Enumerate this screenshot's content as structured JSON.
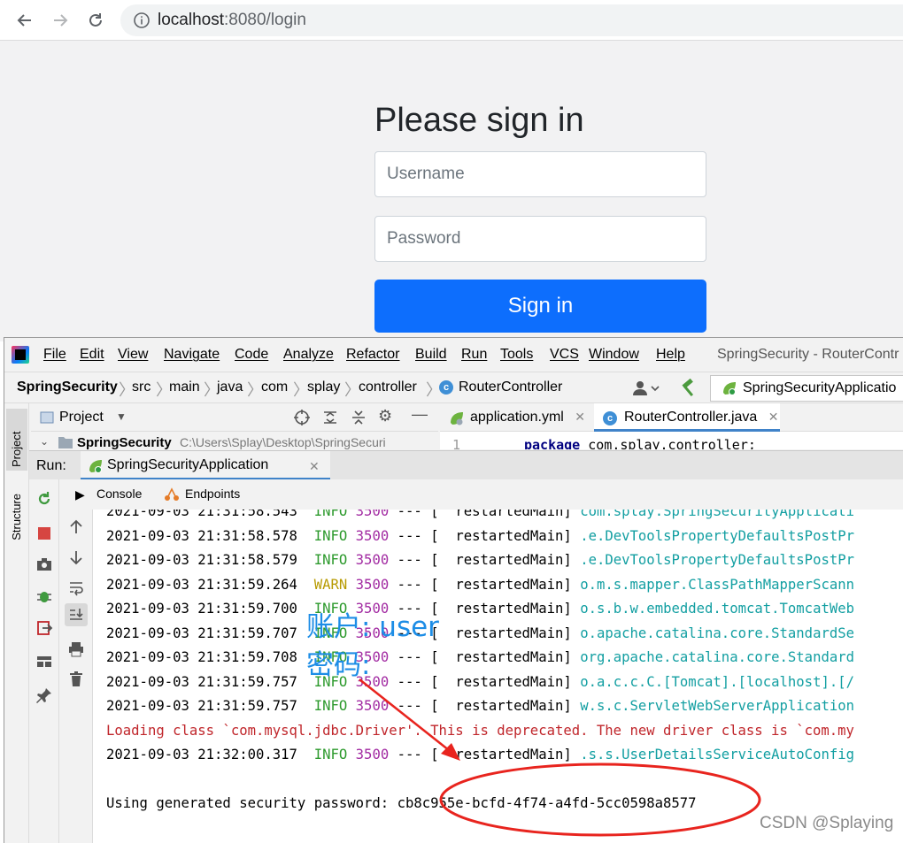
{
  "browser": {
    "url_host": "localhost",
    "url_rest": ":8080/login"
  },
  "login": {
    "title": "Please sign in",
    "username_placeholder": "Username",
    "password_placeholder": "Password",
    "signin_label": "Sign in",
    "button_color": "#0d6efd"
  },
  "ide": {
    "menu": [
      "File",
      "Edit",
      "View",
      "Navigate",
      "Code",
      "Analyze",
      "Refactor",
      "Build",
      "Run",
      "Tools",
      "VCS",
      "Window",
      "Help"
    ],
    "window_title": "SpringSecurity - RouterContr",
    "breadcrumbs": [
      "SpringSecurity",
      "src",
      "main",
      "java",
      "com",
      "splay",
      "controller",
      "RouterController"
    ],
    "run_config": "SpringSecurityApplicatio",
    "project_panel_label": "Project",
    "project_root": "SpringSecurity",
    "project_path": "C:\\Users\\Splay\\Desktop\\SpringSecuri",
    "side_tabs": {
      "project": "Project",
      "structure": "Structure"
    },
    "editor_tabs": [
      {
        "label": "application.yml"
      },
      {
        "label": "RouterController.java"
      }
    ],
    "editor_line_number": "1",
    "editor_code_keyword": "package",
    "editor_code_rest": " com.splay.controller;",
    "run_label": "Run:",
    "run_tab": "SpringSecurityApplication",
    "console_tabs": [
      "Console",
      "Endpoints"
    ],
    "log_lines": [
      {
        "ts": "2021-09-03 21:31:58.543",
        "level": "INFO",
        "pid": "3500",
        "thread": "restartedMain",
        "logger": "com.splay.SpringSecurityApplicati"
      },
      {
        "ts": "2021-09-03 21:31:58.578",
        "level": "INFO",
        "pid": "3500",
        "thread": "restartedMain",
        "logger": ".e.DevToolsPropertyDefaultsPostPr"
      },
      {
        "ts": "2021-09-03 21:31:58.579",
        "level": "INFO",
        "pid": "3500",
        "thread": "restartedMain",
        "logger": ".e.DevToolsPropertyDefaultsPostPr"
      },
      {
        "ts": "2021-09-03 21:31:59.264",
        "level": "WARN",
        "pid": "3500",
        "thread": "restartedMain",
        "logger": "o.m.s.mapper.ClassPathMapperScann"
      },
      {
        "ts": "2021-09-03 21:31:59.700",
        "level": "INFO",
        "pid": "3500",
        "thread": "restartedMain",
        "logger": "o.s.b.w.embedded.tomcat.TomcatWeb"
      },
      {
        "ts": "2021-09-03 21:31:59.707",
        "level": "INFO",
        "pid": "3500",
        "thread": "restartedMain",
        "logger": "o.apache.catalina.core.StandardSe"
      },
      {
        "ts": "2021-09-03 21:31:59.708",
        "level": "INFO",
        "pid": "3500",
        "thread": "restartedMain",
        "logger": "org.apache.catalina.core.Standard"
      },
      {
        "ts": "2021-09-03 21:31:59.757",
        "level": "INFO",
        "pid": "3500",
        "thread": "restartedMain",
        "logger": "o.a.c.c.C.[Tomcat].[localhost].[/"
      },
      {
        "ts": "2021-09-03 21:31:59.757",
        "level": "INFO",
        "pid": "3500",
        "thread": "restartedMain",
        "logger": "w.s.c.ServletWebServerApplication"
      }
    ],
    "deprecation_line": "Loading class `com.mysql.jdbc.Driver'. This is deprecated. The new driver class is `com.my",
    "last_log": {
      "ts": "2021-09-03 21:32:00.317",
      "level": "INFO",
      "pid": "3500",
      "thread": "restartedMain",
      "logger": ".s.s.UserDetailsServiceAutoConfig"
    },
    "password_line": "Using generated security password: cb8c955e-bcfd-4f74-a4fd-5cc0598a8577",
    "sep": "---",
    "bracket": "["
  },
  "annotation": {
    "account_line": "账户: user",
    "password_line": "密码:",
    "color": "#1d8de6",
    "circle_color": "#e8241e"
  },
  "watermark": "CSDN @Splaying"
}
